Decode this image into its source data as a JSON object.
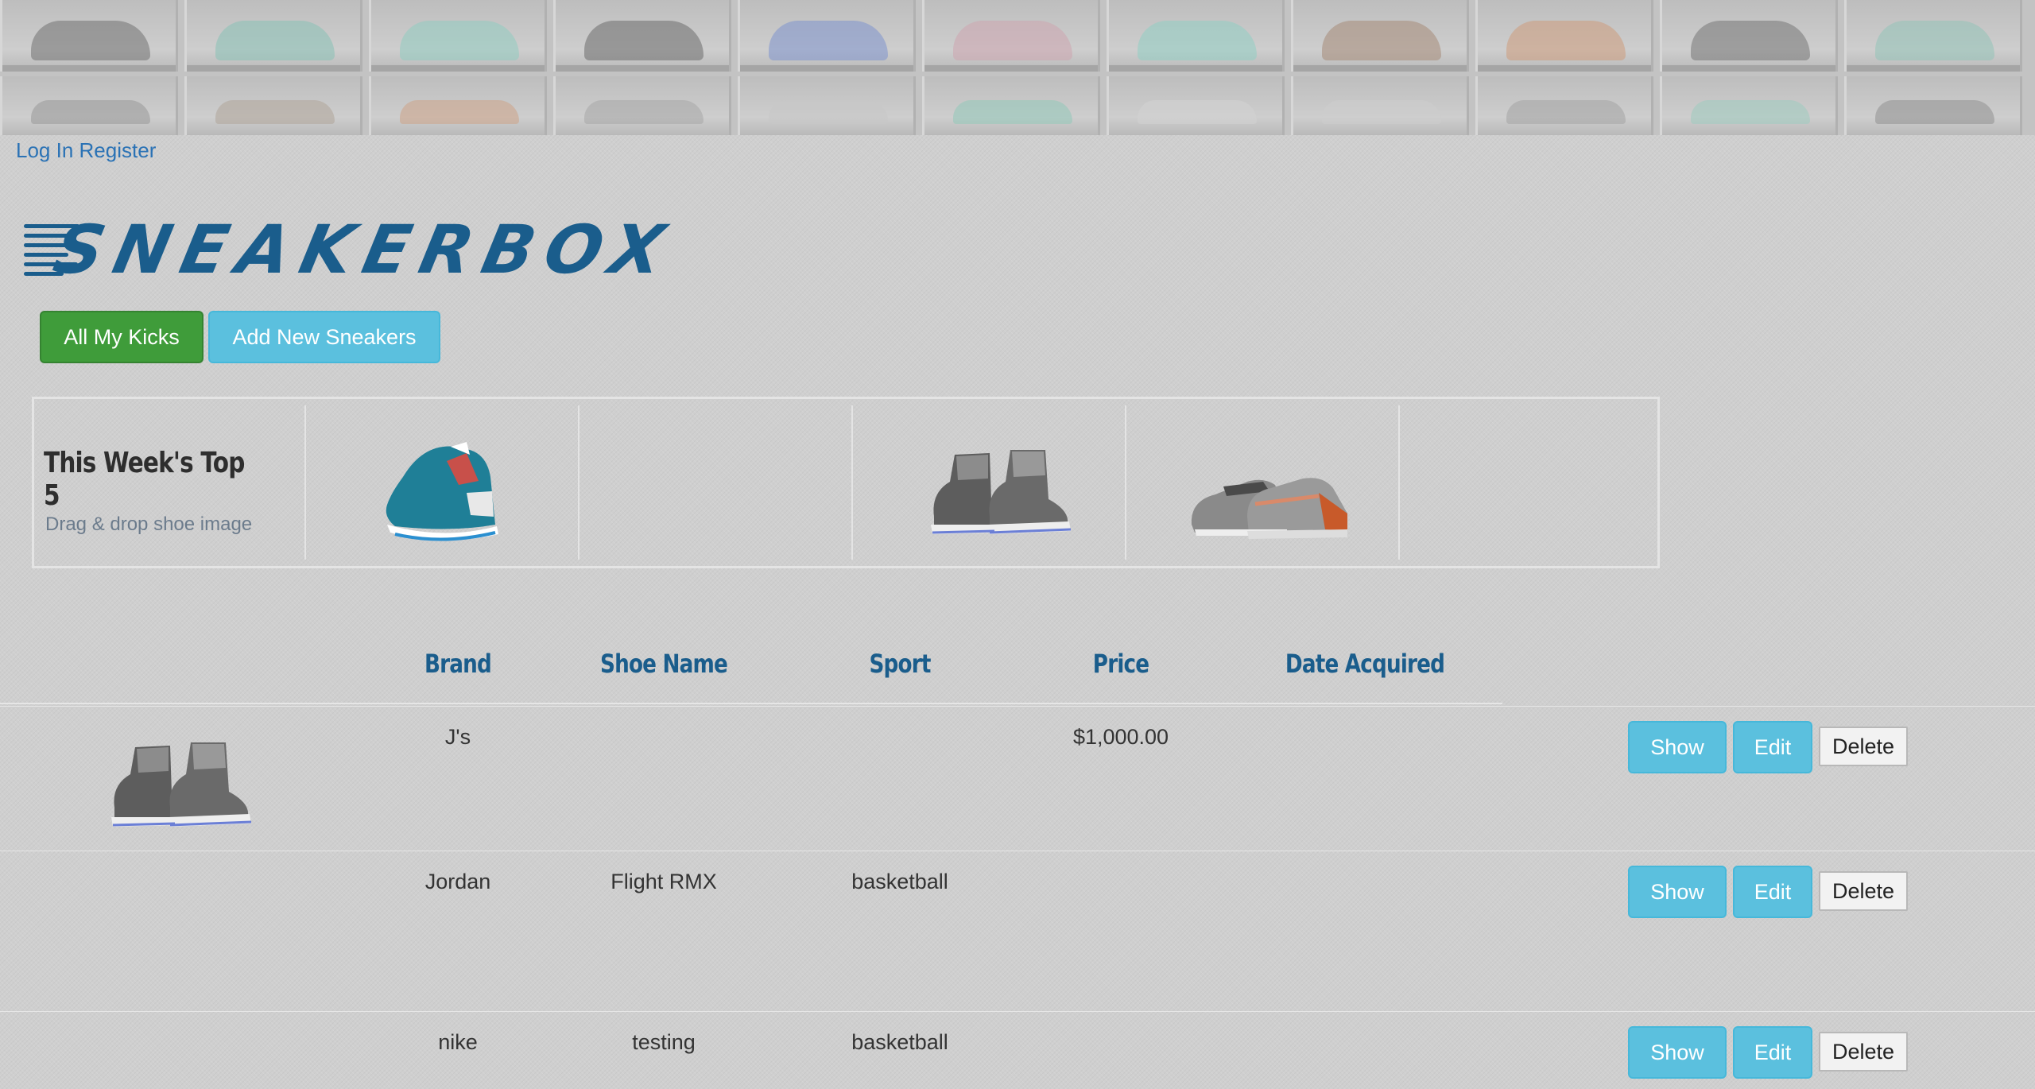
{
  "auth": {
    "login": "Log In",
    "register": "Register"
  },
  "logo": {
    "text": "SNEAKERBOX"
  },
  "nav": {
    "all_kicks": "All My Kicks",
    "add_new": "Add New Sneakers"
  },
  "top5": {
    "title": "This Week's Top 5",
    "hint": "Drag & drop shoe image"
  },
  "table": {
    "headers": [
      "Brand",
      "Shoe Name",
      "Sport",
      "Price",
      "Date Acquired"
    ],
    "rows": [
      {
        "brand": "J's",
        "name": "",
        "sport": "",
        "price": "$1,000.00",
        "date": ""
      },
      {
        "brand": "Jordan",
        "name": "Flight RMX",
        "sport": "basketball",
        "price": "",
        "date": ""
      },
      {
        "brand": "nike",
        "name": "testing",
        "sport": "basketball",
        "price": "",
        "date": ""
      }
    ],
    "actions": {
      "show": "Show",
      "edit": "Edit",
      "delete": "Delete"
    }
  },
  "colors": {
    "accent_blue": "#1a5d8c",
    "info_button": "#5bc0de",
    "success_button": "#3f9c3a",
    "link": "#2a72b5"
  }
}
